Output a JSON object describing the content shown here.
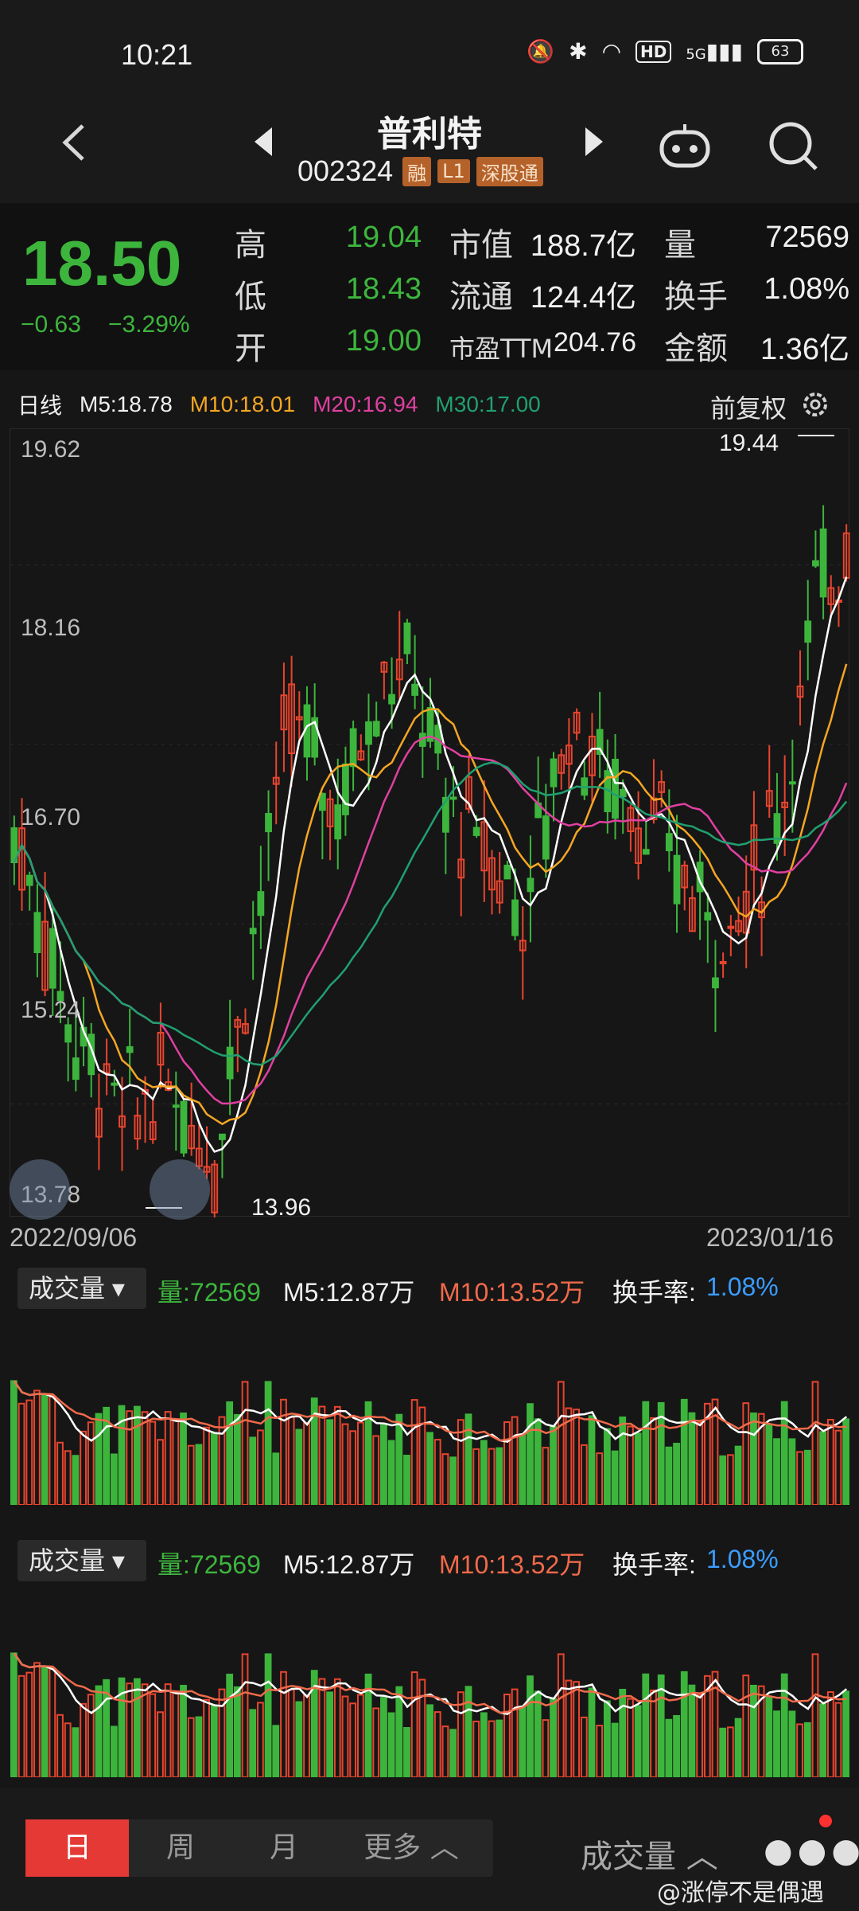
{
  "status": {
    "time": "10:21",
    "battery": "63",
    "hd": "HD",
    "net": "5G"
  },
  "header": {
    "title": "普利特",
    "code": "002324",
    "tags": [
      "融",
      "L1",
      "深股通"
    ]
  },
  "quote": {
    "price": "18.50",
    "change": "−0.63",
    "change_pct": "−3.29%",
    "high_label": "高",
    "high": "19.04",
    "low_label": "低",
    "low": "18.43",
    "open_label": "开",
    "open": "19.00",
    "mcap_label": "市值",
    "mcap": "188.7亿",
    "float_label": "流通",
    "float": "124.4亿",
    "pe_label": "市盈TTM",
    "pe": "204.76",
    "vol_label": "量",
    "vol": "72569",
    "turnover_label": "换手",
    "turnover": "1.08%",
    "amount_label": "金额",
    "amount": "1.36亿"
  },
  "kline": {
    "period": "日线",
    "ma5": "M5:18.78",
    "ma10": "M10:18.01",
    "ma20": "M20:16.94",
    "ma30": "M30:17.00",
    "adjust": "前复权",
    "y_ticks": [
      "19.62",
      "18.16",
      "16.70",
      "15.24",
      "13.78"
    ],
    "max_mark": "19.44",
    "min_mark": "13.96",
    "date_start": "2022/09/06",
    "date_end": "2023/01/16"
  },
  "volume_panel": {
    "selector": "成交量",
    "vol": "量:72569",
    "m5": "M5:12.87万",
    "m10": "M10:13.52万",
    "turnover_label": "换手率:",
    "turnover": "1.08%"
  },
  "colors": {
    "up": "#e8452f",
    "down": "#3db53d",
    "ma5": "#ffffff",
    "ma10": "#f5a623",
    "ma20": "#e040a0",
    "ma30": "#20a070"
  },
  "bottom": {
    "tabs": [
      "日",
      "周",
      "月",
      "更多"
    ],
    "volume_button": "成交量",
    "watermark": "@涨停不是偶遇"
  },
  "chart_data": {
    "type": "candlestick",
    "x_range": [
      "2022/09/06",
      "2023/01/16"
    ],
    "ylim": [
      13.78,
      19.62
    ],
    "max": 19.44,
    "min": 13.96,
    "last_close": 18.5
  }
}
